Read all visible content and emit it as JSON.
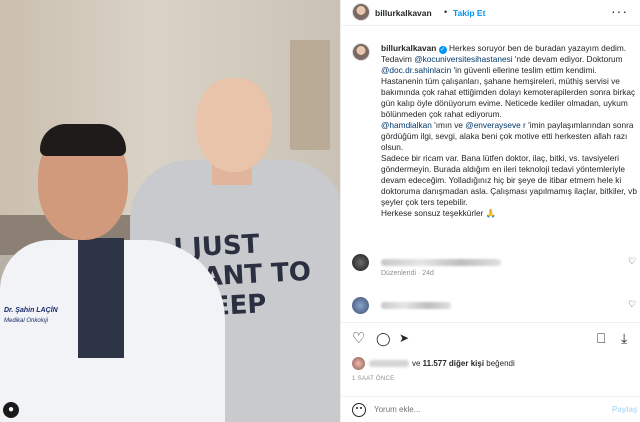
{
  "photo": {
    "shirt_text": "I JUST WANT TO SLEEP",
    "badge_name": "Dr. Şahin LAÇİN",
    "badge_title": "Medikal Onkoloji"
  },
  "header": {
    "username": "billurkalkavan",
    "separator": "•",
    "follow_label": "Takip Et",
    "more_label": "···"
  },
  "caption": {
    "username": "billurkalkavan",
    "verified_glyph": "✓",
    "lines": [
      "Herkes soruyor ben de buradan yazayım dedim.",
      "Tedavim ",
      "@kocuniversitesihastanesi",
      " 'nde devam ediyor. Doktorum",
      "@doc.dr.sahinlacin",
      " 'in güvenli ellerine teslim ettim kendimi.",
      "Hastanenin tüm çalışanları, şahane hemşireleri, müthiş servisi ve bakımında çok rahat ettiğimden dolayı kemoterapilerden sonra birkaç gün kalıp öyle dönüyorum evime. Neticede kediler olmadan, uykum bölünmeden çok rahat ediyorum.",
      "@hamdialkan",
      " 'ımın ve ",
      "@enverayseve r",
      " 'imin paylaşımlarından sonra gördüğüm ilgi, sevgi, alaka beni çok motive etti herkesten allah razı olsun.",
      "Sadece bir ricam var. Bana lütfen doktor, ilaç, bitki, vs. tavsiyeleri göndermeyin. Burada aldığım en ileri teknoloji tedavi yöntemleriyle devam edeceğim. Yolladığınız hiç bir şeye de itibar etmem hele ki doktoruma danışmadan asla. Çalışması yapılmamış ilaçlar, bitkiler, vb şeyler çok ters tepebilir.",
      "Herkese sonsuz teşekkürler 🙏"
    ],
    "edited": "Düzenlendi · 24d"
  },
  "actions": {
    "like_icon": "♡",
    "comment_icon": "◯",
    "share_icon": "➤",
    "save_icon": "⎕",
    "download_icon": "⤓",
    "comment_heart": "♡"
  },
  "likes": {
    "text_middle": "ve ",
    "count": "11.577 diğer kişi",
    "text_end": " beğendi"
  },
  "time_ago": "1 SAAT ÖNCE",
  "comment_box": {
    "placeholder": "Yorum ekle...",
    "post_label": "Paylaş"
  }
}
